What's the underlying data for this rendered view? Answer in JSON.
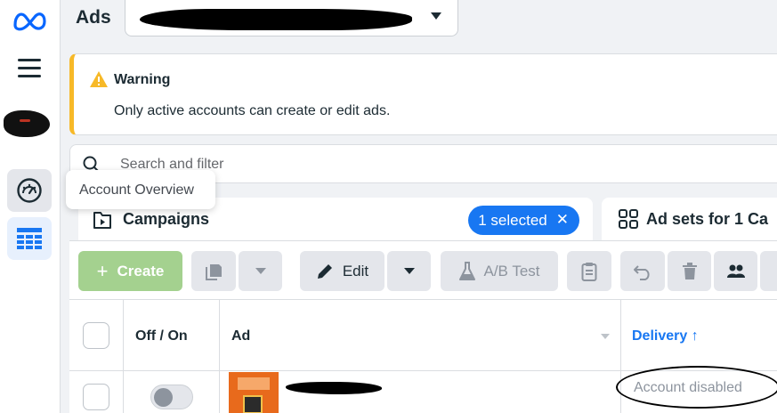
{
  "header": {
    "title": "Ads"
  },
  "warning": {
    "title": "Warning",
    "message": "Only active accounts can create or edit ads."
  },
  "search": {
    "placeholder": "Search and filter"
  },
  "tooltip": {
    "text": "Account Overview"
  },
  "tabs": {
    "campaigns": {
      "label": "Campaigns",
      "selected_chip": "1 selected",
      "chip_close": "✕"
    },
    "adsets": {
      "label": "Ad sets for 1 Ca"
    }
  },
  "toolbar": {
    "create_plus": "+",
    "create_label": "Create",
    "edit_label": "Edit",
    "ab_test_label": "A/B Test"
  },
  "table": {
    "headers": {
      "onoff": "Off / On",
      "ad": "Ad",
      "delivery": "Delivery ↑"
    },
    "rows": [
      {
        "delivery": "Account disabled",
        "toggle_on": false
      }
    ]
  },
  "colors": {
    "accent": "#1877f2",
    "warning": "#f7b928",
    "create_disabled": "#a4d18f"
  },
  "icons": [
    "meta-logo-icon",
    "hamburger-icon",
    "gauge-icon",
    "grid-table-icon",
    "warning-icon",
    "search-icon",
    "campaign-folder-icon",
    "adsets-grid-icon",
    "duplicate-icon",
    "pencil-icon",
    "flask-icon",
    "clipboard-icon",
    "undo-icon",
    "trash-icon",
    "audience-icon"
  ]
}
